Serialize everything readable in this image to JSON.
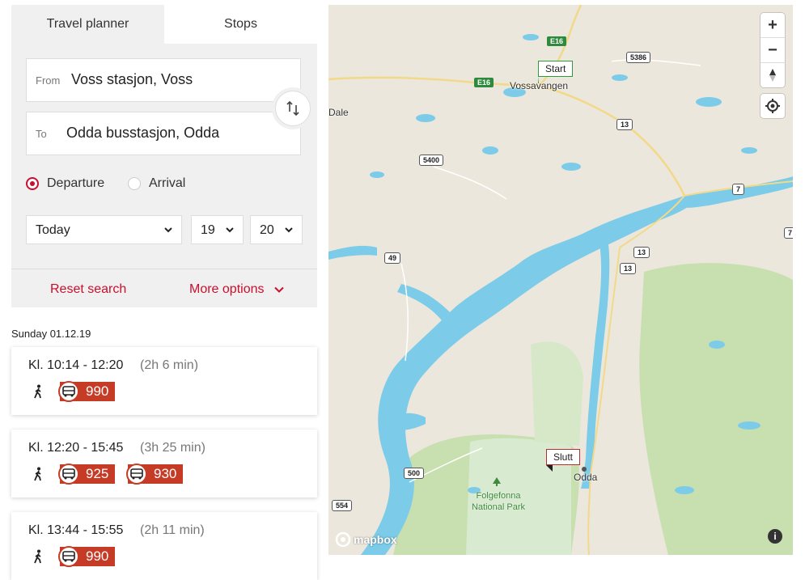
{
  "tabs": [
    {
      "label": "Travel planner",
      "active": true
    },
    {
      "label": "Stops",
      "active": false
    }
  ],
  "form": {
    "from_label": "From",
    "from_value": "Voss stasjon, Voss",
    "to_label": "To",
    "to_value": "Odda busstasjon, Odda",
    "departure_label": "Departure",
    "arrival_label": "Arrival",
    "selected_mode": "Departure",
    "day": "Today",
    "hour": "19",
    "minute": "20",
    "reset_label": "Reset search",
    "more_label": "More options"
  },
  "results": {
    "date_heading": "Sunday 01.12.19",
    "trips": [
      {
        "time": "Kl. 10:14 - 12:20",
        "duration": "(2h 6 min)",
        "lines": [
          "990"
        ]
      },
      {
        "time": "Kl. 12:20 - 15:45",
        "duration": "(3h 25 min)",
        "lines": [
          "925",
          "930"
        ]
      },
      {
        "time": "Kl. 13:44 - 15:55",
        "duration": "(2h 11 min)",
        "lines": [
          "990"
        ]
      }
    ]
  },
  "map": {
    "start_marker": "Start",
    "end_marker": "Slutt",
    "places": {
      "vossavangen": "Vossavangen",
      "dale": "Dale",
      "odda": "Odda",
      "park": "Folgefonna National Park"
    },
    "roads": {
      "e16_a": "E16",
      "e16_b": "E16",
      "r5386": "5386",
      "r13_a": "13",
      "r13_b": "13",
      "r13_c": "13",
      "r5400": "5400",
      "r7": "7",
      "r49": "49",
      "r500": "500",
      "r554": "554",
      "r7_edge": "7"
    },
    "controls": {
      "zoom_in": "+",
      "zoom_out": "−",
      "info": "i"
    },
    "attribution": "mapbox",
    "colors": {
      "water": "#7ccbe8",
      "land": "#ece7dc",
      "park": "#c8dfb0",
      "accent": "#c8102e",
      "bus": "#c63b26"
    }
  }
}
